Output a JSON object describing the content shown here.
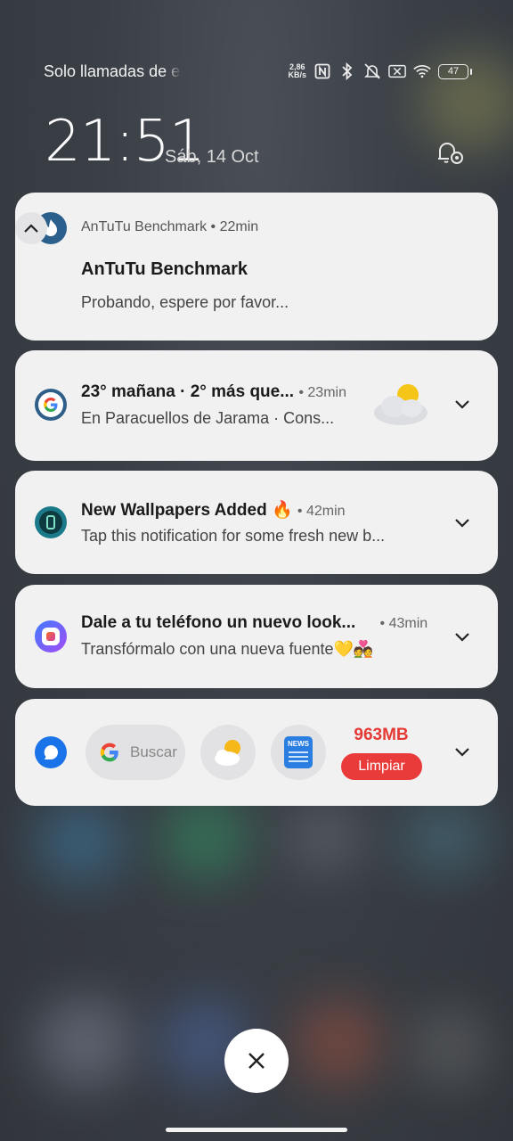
{
  "status_bar": {
    "carrier": "Solo llamadas de emergencia",
    "speed_value": "2,86",
    "speed_unit": "KB/s",
    "battery": "47",
    "icons": [
      "nfc-icon",
      "bluetooth-icon",
      "mute-vibrate-icon",
      "no-sim-icon",
      "wifi-icon",
      "battery-icon"
    ]
  },
  "lockscreen": {
    "time": "21:51",
    "date": "Sáb, 14 Oct"
  },
  "notifications": [
    {
      "app": "AnTuTu Benchmark",
      "time": "• 22min",
      "title": "AnTuTu Benchmark",
      "body": "Probando, espere por favor...",
      "icon": "antutu-flame-icon",
      "expanded": true
    },
    {
      "title": "23° mañana · 2° más que...",
      "time": "• 23min",
      "body": "En Paracuellos de Jarama · Cons...",
      "icon": "google-icon",
      "image": "partly-cloudy-icon"
    },
    {
      "title": "New Wallpapers Added 🔥",
      "time": "• 42min",
      "body": "Tap this notification for some fresh new b...",
      "icon": "walls-app-icon"
    },
    {
      "title": "Dale a tu teléfono un nuevo look...",
      "time": "• 43min",
      "body": "Transfórmalo con una nueva fuente💛💑",
      "icon": "themes-app-icon"
    }
  ],
  "widget": {
    "search_placeholder": "Buscar",
    "news_label": "NEWS",
    "memory": "963MB",
    "clean_label": "Limpiar"
  },
  "colors": {
    "card_bg": "#f1f1f2",
    "accent_red": "#ea3b3b",
    "antutu_blue": "#2b5f8c"
  }
}
